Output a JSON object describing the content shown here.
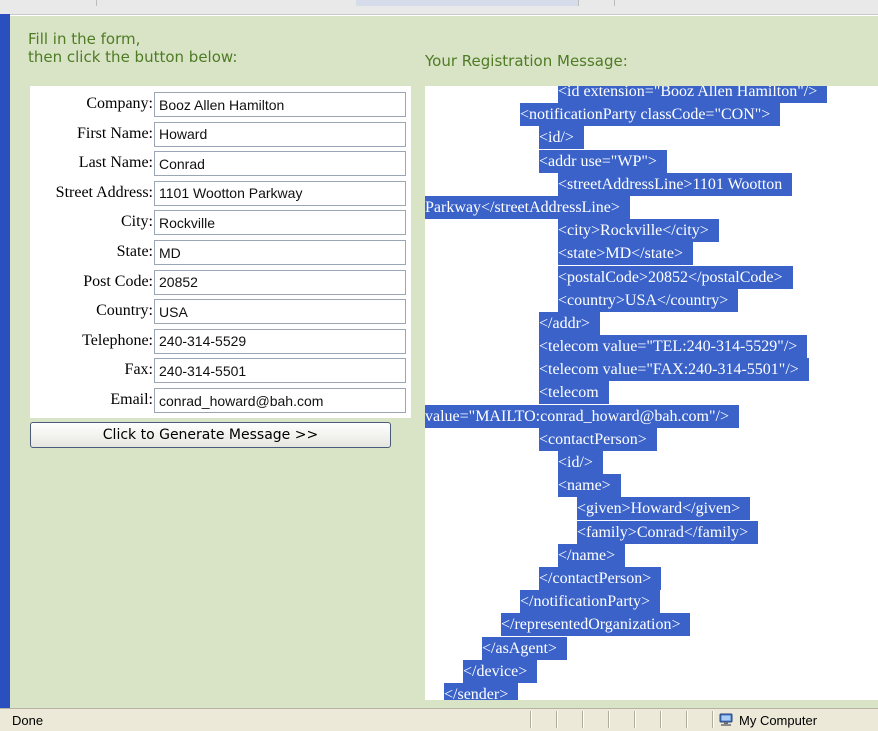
{
  "instructions": {
    "line1": "Fill in the form,",
    "line2": "then click the button below:"
  },
  "message_title": "Your Registration Message:",
  "form": {
    "fields": [
      {
        "label": "Company:",
        "value": "Booz Allen Hamilton"
      },
      {
        "label": "First Name:",
        "value": "Howard"
      },
      {
        "label": "Last Name:",
        "value": "Conrad"
      },
      {
        "label": "Street Address:",
        "value": "1101 Wootton Parkway"
      },
      {
        "label": "City:",
        "value": "Rockville"
      },
      {
        "label": "State:",
        "value": "MD"
      },
      {
        "label": "Post Code:",
        "value": "20852"
      },
      {
        "label": "Country:",
        "value": "USA"
      },
      {
        "label": "Telephone:",
        "value": "240-314-5529"
      },
      {
        "label": "Fax:",
        "value": "240-314-5501"
      },
      {
        "label": "Email:",
        "value": "conrad_howard@bah.com"
      }
    ],
    "button_label": "Click to Generate Message >>"
  },
  "message_lines": [
    {
      "indent": 7,
      "text": "<id extension=\"Booz Allen Hamilton\"/>"
    },
    {
      "indent": 5,
      "text": "<notificationParty classCode=\"CON\">"
    },
    {
      "indent": 6,
      "text": "<id/>"
    },
    {
      "indent": 6,
      "text": "<addr use=\"WP\">"
    },
    {
      "indent": 7,
      "text": "<streetAddressLine>1101 Wootton"
    },
    {
      "indent": 0,
      "text": "Parkway</streetAddressLine>"
    },
    {
      "indent": 7,
      "text": "<city>Rockville</city>"
    },
    {
      "indent": 7,
      "text": "<state>MD</state>"
    },
    {
      "indent": 7,
      "text": "<postalCode>20852</postalCode>"
    },
    {
      "indent": 7,
      "text": "<country>USA</country>"
    },
    {
      "indent": 6,
      "text": "</addr>"
    },
    {
      "indent": 6,
      "text": "<telecom value=\"TEL:240-314-5529\"/>"
    },
    {
      "indent": 6,
      "text": "<telecom value=\"FAX:240-314-5501\"/>"
    },
    {
      "indent": 6,
      "text": "<telecom"
    },
    {
      "indent": 0,
      "text": "value=\"MAILTO:conrad_howard@bah.com\"/>"
    },
    {
      "indent": 6,
      "text": "<contactPerson>"
    },
    {
      "indent": 7,
      "text": "<id/>"
    },
    {
      "indent": 7,
      "text": "<name>"
    },
    {
      "indent": 8,
      "text": "<given>Howard</given>"
    },
    {
      "indent": 8,
      "text": "<family>Conrad</family>"
    },
    {
      "indent": 7,
      "text": "</name>"
    },
    {
      "indent": 6,
      "text": "</contactPerson>"
    },
    {
      "indent": 5,
      "text": "</notificationParty>"
    },
    {
      "indent": 4,
      "text": "</representedOrganization>"
    },
    {
      "indent": 3,
      "text": "</asAgent>"
    },
    {
      "indent": 2,
      "text": "</device>"
    },
    {
      "indent": 1,
      "text": "</sender>"
    }
  ],
  "statusbar": {
    "status": "Done",
    "zone": "My Computer"
  },
  "colors": {
    "page_background": "#d9e4c7",
    "heading_text": "#4e7b24",
    "selection_highlight": "#3a62c9"
  },
  "icons": {
    "zone": "computer-icon"
  }
}
